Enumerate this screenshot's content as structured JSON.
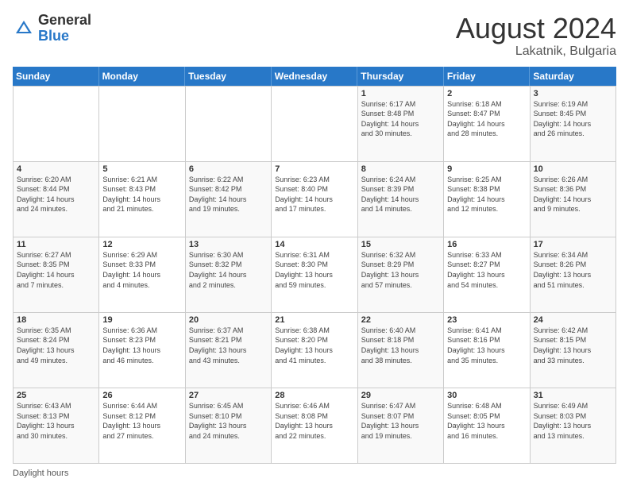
{
  "logo": {
    "general": "General",
    "blue": "Blue"
  },
  "title": "August 2024",
  "subtitle": "Lakatnik, Bulgaria",
  "header_days": [
    "Sunday",
    "Monday",
    "Tuesday",
    "Wednesday",
    "Thursday",
    "Friday",
    "Saturday"
  ],
  "footer": "Daylight hours",
  "weeks": [
    [
      {
        "day": "",
        "info": ""
      },
      {
        "day": "",
        "info": ""
      },
      {
        "day": "",
        "info": ""
      },
      {
        "day": "",
        "info": ""
      },
      {
        "day": "1",
        "info": "Sunrise: 6:17 AM\nSunset: 8:48 PM\nDaylight: 14 hours\nand 30 minutes."
      },
      {
        "day": "2",
        "info": "Sunrise: 6:18 AM\nSunset: 8:47 PM\nDaylight: 14 hours\nand 28 minutes."
      },
      {
        "day": "3",
        "info": "Sunrise: 6:19 AM\nSunset: 8:45 PM\nDaylight: 14 hours\nand 26 minutes."
      }
    ],
    [
      {
        "day": "4",
        "info": "Sunrise: 6:20 AM\nSunset: 8:44 PM\nDaylight: 14 hours\nand 24 minutes."
      },
      {
        "day": "5",
        "info": "Sunrise: 6:21 AM\nSunset: 8:43 PM\nDaylight: 14 hours\nand 21 minutes."
      },
      {
        "day": "6",
        "info": "Sunrise: 6:22 AM\nSunset: 8:42 PM\nDaylight: 14 hours\nand 19 minutes."
      },
      {
        "day": "7",
        "info": "Sunrise: 6:23 AM\nSunset: 8:40 PM\nDaylight: 14 hours\nand 17 minutes."
      },
      {
        "day": "8",
        "info": "Sunrise: 6:24 AM\nSunset: 8:39 PM\nDaylight: 14 hours\nand 14 minutes."
      },
      {
        "day": "9",
        "info": "Sunrise: 6:25 AM\nSunset: 8:38 PM\nDaylight: 14 hours\nand 12 minutes."
      },
      {
        "day": "10",
        "info": "Sunrise: 6:26 AM\nSunset: 8:36 PM\nDaylight: 14 hours\nand 9 minutes."
      }
    ],
    [
      {
        "day": "11",
        "info": "Sunrise: 6:27 AM\nSunset: 8:35 PM\nDaylight: 14 hours\nand 7 minutes."
      },
      {
        "day": "12",
        "info": "Sunrise: 6:29 AM\nSunset: 8:33 PM\nDaylight: 14 hours\nand 4 minutes."
      },
      {
        "day": "13",
        "info": "Sunrise: 6:30 AM\nSunset: 8:32 PM\nDaylight: 14 hours\nand 2 minutes."
      },
      {
        "day": "14",
        "info": "Sunrise: 6:31 AM\nSunset: 8:30 PM\nDaylight: 13 hours\nand 59 minutes."
      },
      {
        "day": "15",
        "info": "Sunrise: 6:32 AM\nSunset: 8:29 PM\nDaylight: 13 hours\nand 57 minutes."
      },
      {
        "day": "16",
        "info": "Sunrise: 6:33 AM\nSunset: 8:27 PM\nDaylight: 13 hours\nand 54 minutes."
      },
      {
        "day": "17",
        "info": "Sunrise: 6:34 AM\nSunset: 8:26 PM\nDaylight: 13 hours\nand 51 minutes."
      }
    ],
    [
      {
        "day": "18",
        "info": "Sunrise: 6:35 AM\nSunset: 8:24 PM\nDaylight: 13 hours\nand 49 minutes."
      },
      {
        "day": "19",
        "info": "Sunrise: 6:36 AM\nSunset: 8:23 PM\nDaylight: 13 hours\nand 46 minutes."
      },
      {
        "day": "20",
        "info": "Sunrise: 6:37 AM\nSunset: 8:21 PM\nDaylight: 13 hours\nand 43 minutes."
      },
      {
        "day": "21",
        "info": "Sunrise: 6:38 AM\nSunset: 8:20 PM\nDaylight: 13 hours\nand 41 minutes."
      },
      {
        "day": "22",
        "info": "Sunrise: 6:40 AM\nSunset: 8:18 PM\nDaylight: 13 hours\nand 38 minutes."
      },
      {
        "day": "23",
        "info": "Sunrise: 6:41 AM\nSunset: 8:16 PM\nDaylight: 13 hours\nand 35 minutes."
      },
      {
        "day": "24",
        "info": "Sunrise: 6:42 AM\nSunset: 8:15 PM\nDaylight: 13 hours\nand 33 minutes."
      }
    ],
    [
      {
        "day": "25",
        "info": "Sunrise: 6:43 AM\nSunset: 8:13 PM\nDaylight: 13 hours\nand 30 minutes."
      },
      {
        "day": "26",
        "info": "Sunrise: 6:44 AM\nSunset: 8:12 PM\nDaylight: 13 hours\nand 27 minutes."
      },
      {
        "day": "27",
        "info": "Sunrise: 6:45 AM\nSunset: 8:10 PM\nDaylight: 13 hours\nand 24 minutes."
      },
      {
        "day": "28",
        "info": "Sunrise: 6:46 AM\nSunset: 8:08 PM\nDaylight: 13 hours\nand 22 minutes."
      },
      {
        "day": "29",
        "info": "Sunrise: 6:47 AM\nSunset: 8:07 PM\nDaylight: 13 hours\nand 19 minutes."
      },
      {
        "day": "30",
        "info": "Sunrise: 6:48 AM\nSunset: 8:05 PM\nDaylight: 13 hours\nand 16 minutes."
      },
      {
        "day": "31",
        "info": "Sunrise: 6:49 AM\nSunset: 8:03 PM\nDaylight: 13 hours\nand 13 minutes."
      }
    ]
  ]
}
